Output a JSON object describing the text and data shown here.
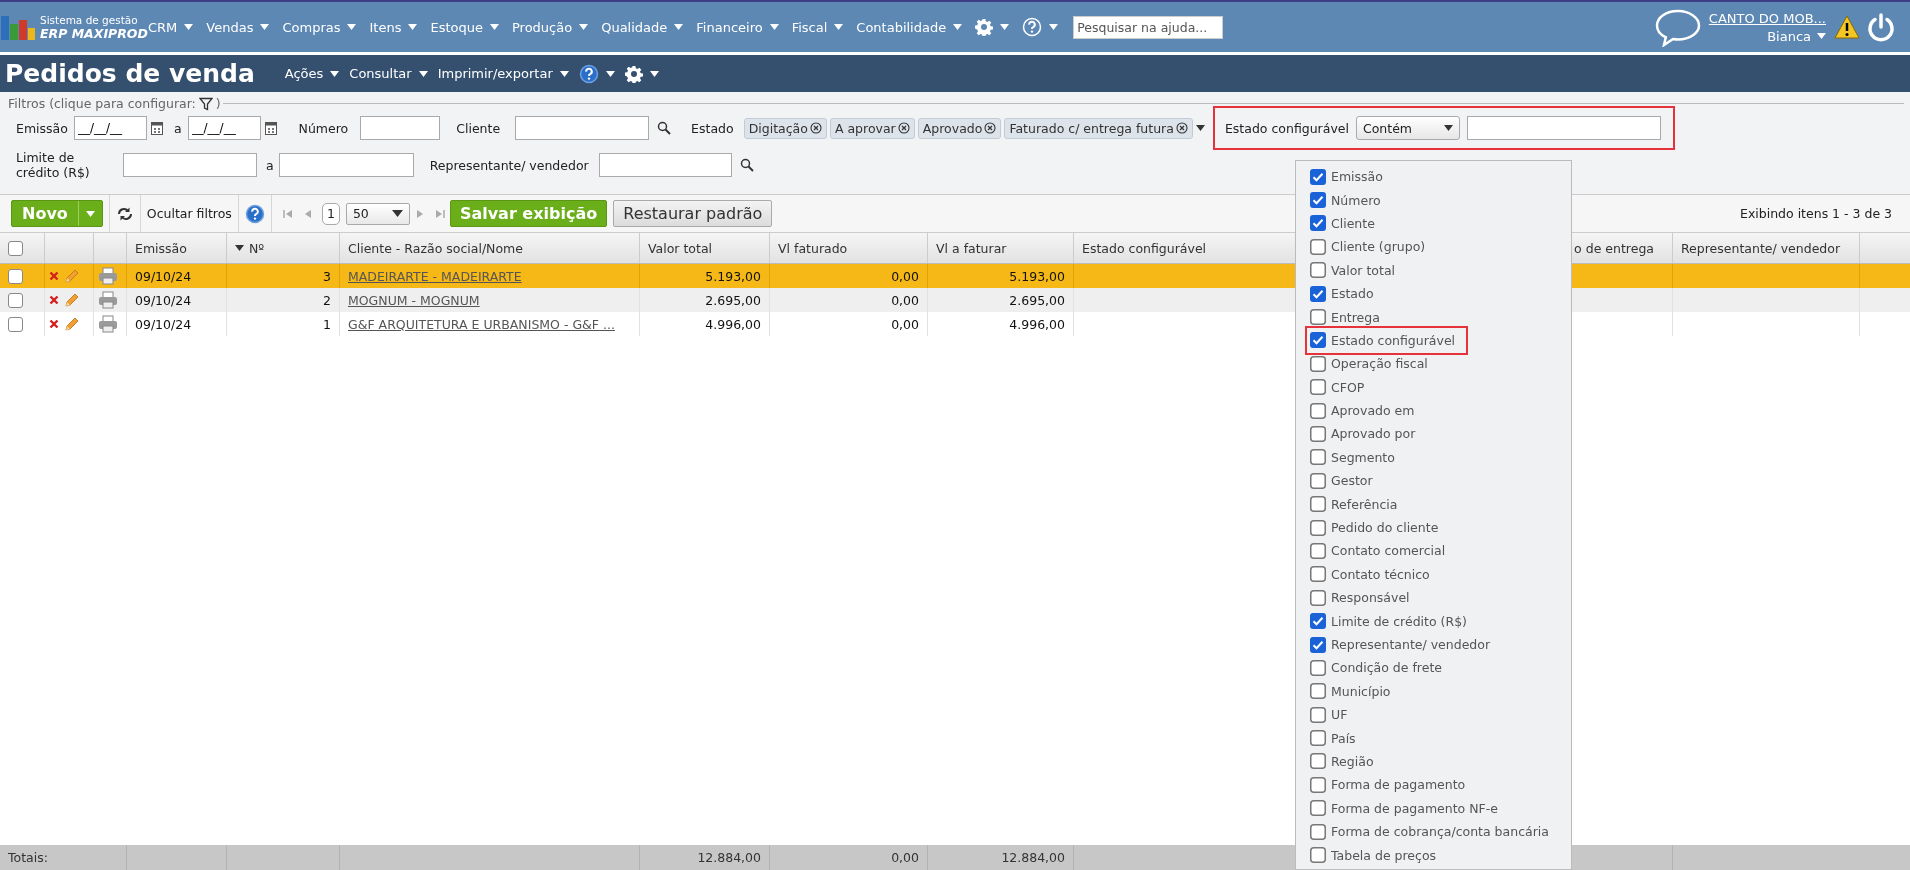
{
  "top_nav": {
    "logo": {
      "line1": "Sistema de gestão",
      "line2": "ERP MAXIPROD"
    },
    "menus": [
      "CRM",
      "Vendas",
      "Compras",
      "Itens",
      "Estoque",
      "Produção",
      "Qualidade",
      "Financeiro",
      "Fiscal",
      "Contabilidade"
    ],
    "search": {
      "placeholder": "Pesquisar na ajuda..."
    },
    "company": "CANTO DO MOB...",
    "user": "Bianca"
  },
  "page_bar": {
    "title": "Pedidos de venda",
    "menus": [
      "Ações",
      "Consultar",
      "Imprimir/exportar"
    ]
  },
  "filters": {
    "legend": "Filtros (clique para configurar:",
    "legend_end": ")",
    "emissao": {
      "label": "Emissão",
      "from": "__/__/__",
      "separator": "a",
      "to": "__/__/__"
    },
    "numero": {
      "label": "Número"
    },
    "cliente": {
      "label": "Cliente"
    },
    "estado": {
      "label": "Estado",
      "tags": [
        "Digitação",
        "A aprovar",
        "Aprovado",
        "Faturado c/ entrega futura"
      ]
    },
    "estado_configuravel": {
      "label": "Estado configurável",
      "operator": "Contém",
      "highlighted": true
    },
    "limite": {
      "label": "Limite de crédito (R$)",
      "separator": "a"
    },
    "representante": {
      "label": "Representante/ vendedor"
    }
  },
  "toolbar": {
    "new": "Novo",
    "hide_filters": "Ocultar filtros",
    "page": "1",
    "page_size": "50",
    "save": "Salvar exibição",
    "restore": "Restaurar padrão",
    "info": "Exibindo itens 1 - 3 de 3"
  },
  "table": {
    "select_all": {
      "checked": false
    },
    "columns": [
      {
        "label": "Emissão",
        "sorted": false
      },
      {
        "label": "Nº",
        "sorted": true
      },
      {
        "label": "Cliente - Razão social/Nome",
        "sorted": false
      },
      {
        "label": "Valor total",
        "sorted": false
      },
      {
        "label": "Vl faturado",
        "sorted": false
      },
      {
        "label": "Vl a faturar",
        "sorted": false
      },
      {
        "label": "Estado configurável",
        "sorted": false
      },
      {
        "label": "o de entrega",
        "sorted": false
      },
      {
        "label": "Representante/ vendedor",
        "sorted": false
      }
    ],
    "rows": [
      {
        "selected": true,
        "checked": false,
        "emissao": "09/10/24",
        "numero": "3",
        "cliente": "MADEIRARTE - MADEIRARTE",
        "valor_total": "5.193,00",
        "vl_faturado": "0,00",
        "vl_a_faturar": "5.193,00"
      },
      {
        "selected": false,
        "checked": false,
        "emissao": "09/10/24",
        "numero": "2",
        "cliente": "MOGNUM - MOGNUM",
        "valor_total": "2.695,00",
        "vl_faturado": "0,00",
        "vl_a_faturar": "2.695,00"
      },
      {
        "selected": false,
        "checked": false,
        "emissao": "09/10/24",
        "numero": "1",
        "cliente": "G&F ARQUITETURA E URBANISMO - G&F ...",
        "valor_total": "4.996,00",
        "vl_faturado": "0,00",
        "vl_a_faturar": "4.996,00"
      }
    ],
    "totals": {
      "label": "Totais:",
      "valor_total": "12.884,00",
      "vl_faturado": "0,00",
      "vl_a_faturar": "12.884,00"
    }
  },
  "columns_menu": {
    "items": [
      {
        "label": "Emissão",
        "checked": true,
        "highlighted": false
      },
      {
        "label": "Número",
        "checked": true,
        "highlighted": false
      },
      {
        "label": "Cliente",
        "checked": true,
        "highlighted": false
      },
      {
        "label": "Cliente (grupo)",
        "checked": false,
        "highlighted": false
      },
      {
        "label": "Valor total",
        "checked": false,
        "highlighted": false
      },
      {
        "label": "Estado",
        "checked": true,
        "highlighted": false
      },
      {
        "label": "Entrega",
        "checked": false,
        "highlighted": false
      },
      {
        "label": "Estado configurável",
        "checked": true,
        "highlighted": true
      },
      {
        "label": "Operação fiscal",
        "checked": false,
        "highlighted": false
      },
      {
        "label": "CFOP",
        "checked": false,
        "highlighted": false
      },
      {
        "label": "Aprovado em",
        "checked": false,
        "highlighted": false
      },
      {
        "label": "Aprovado por",
        "checked": false,
        "highlighted": false
      },
      {
        "label": "Segmento",
        "checked": false,
        "highlighted": false
      },
      {
        "label": "Gestor",
        "checked": false,
        "highlighted": false
      },
      {
        "label": "Referência",
        "checked": false,
        "highlighted": false
      },
      {
        "label": "Pedido do cliente",
        "checked": false,
        "highlighted": false
      },
      {
        "label": "Contato comercial",
        "checked": false,
        "highlighted": false
      },
      {
        "label": "Contato técnico",
        "checked": false,
        "highlighted": false
      },
      {
        "label": "Responsável",
        "checked": false,
        "highlighted": false
      },
      {
        "label": "Limite de crédito (R$)",
        "checked": true,
        "highlighted": false
      },
      {
        "label": "Representante/ vendedor",
        "checked": true,
        "highlighted": false
      },
      {
        "label": "Condição de frete",
        "checked": false,
        "highlighted": false
      },
      {
        "label": "Município",
        "checked": false,
        "highlighted": false
      },
      {
        "label": "UF",
        "checked": false,
        "highlighted": false
      },
      {
        "label": "País",
        "checked": false,
        "highlighted": false
      },
      {
        "label": "Região",
        "checked": false,
        "highlighted": false
      },
      {
        "label": "Forma de pagamento",
        "checked": false,
        "highlighted": false
      },
      {
        "label": "Forma de pagamento NF-e",
        "checked": false,
        "highlighted": false
      },
      {
        "label": "Forma de cobrança/conta bancária",
        "checked": false,
        "highlighted": false
      },
      {
        "label": "Tabela de preços",
        "checked": false,
        "highlighted": false
      }
    ]
  }
}
